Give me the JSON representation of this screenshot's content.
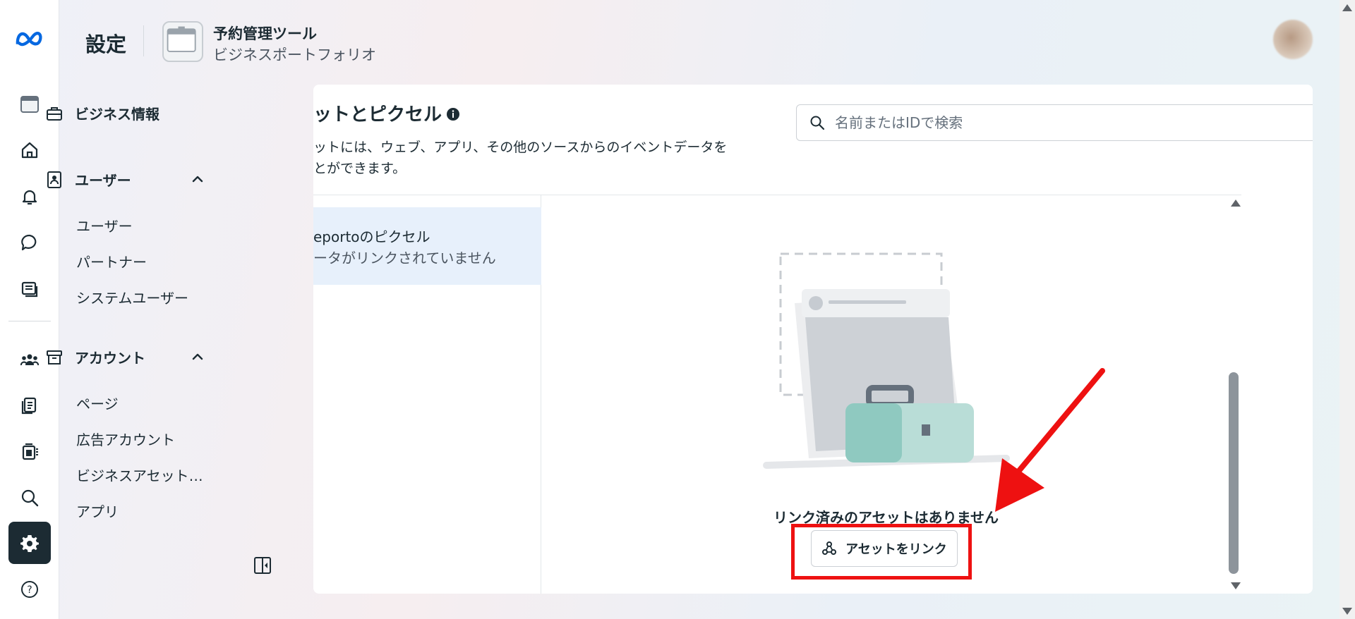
{
  "header": {
    "title": "設定",
    "portfolio_name": "予約管理ツール",
    "portfolio_type": "ビジネスポートフォリオ"
  },
  "rail": {
    "icons": [
      "meta-logo-icon",
      "portfolio-icon",
      "home-icon",
      "bell-icon",
      "chat-icon",
      "ads-icon",
      "people-icon",
      "pages-icon",
      "billing-icon",
      "search-icon",
      "gear-icon",
      "help-icon"
    ],
    "active": "gear-icon"
  },
  "nav": {
    "business_info": "ビジネス情報",
    "users": {
      "label": "ユーザー",
      "items": [
        "ユーザー",
        "パートナー",
        "システムユーザー"
      ]
    },
    "accounts": {
      "label": "アカウント",
      "items": [
        "ページ",
        "広告アカウント",
        "ビジネスアセット…",
        "アプリ"
      ]
    }
  },
  "main": {
    "title": "ットとピクセル",
    "description_line1": "ットには、ウェブ、アプリ、その他のソースからのイベントデータを",
    "description_line2": "とができます。",
    "search_placeholder": "名前またはIDで検索",
    "list_item": {
      "title": "eportoのピクセル",
      "subtitle": "ータがリンクされていません"
    },
    "empty_state": {
      "message": "リンク済みのアセットはありません",
      "button_label": "アセットをリンク"
    }
  },
  "annotation_color": "#ee1111",
  "accent_color": "#1c2b33"
}
